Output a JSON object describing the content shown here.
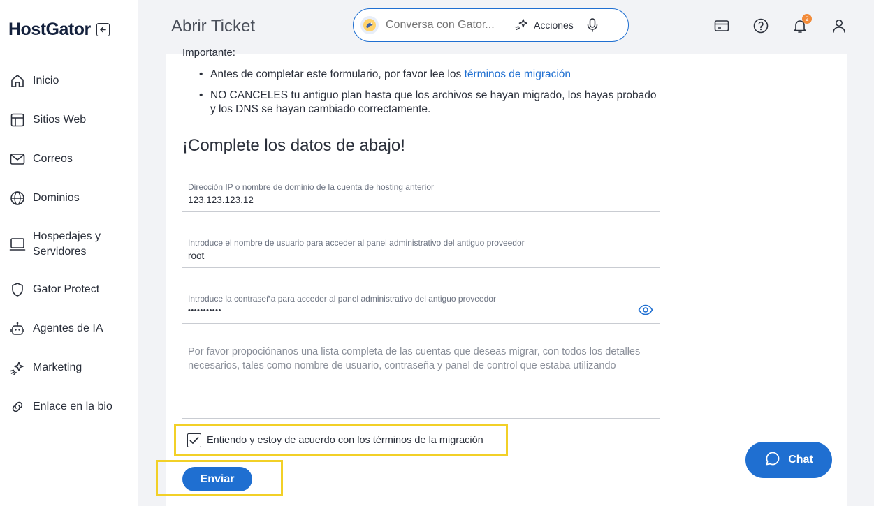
{
  "app": {
    "logo": "HostGator",
    "page_title": "Abrir Ticket"
  },
  "sidebar": {
    "items": [
      {
        "label": "Inicio",
        "icon": "home-icon"
      },
      {
        "label": "Sitios Web",
        "icon": "layout-icon"
      },
      {
        "label": "Correos",
        "icon": "mail-icon"
      },
      {
        "label": "Dominios",
        "icon": "globe-icon"
      },
      {
        "label": "Hospedajes y Servidores",
        "icon": "laptop-icon"
      },
      {
        "label": "Gator Protect",
        "icon": "shield-icon"
      },
      {
        "label": "Agentes de IA",
        "icon": "robot-icon"
      },
      {
        "label": "Marketing",
        "icon": "sparkle-icon"
      },
      {
        "label": "Enlace en la bio",
        "icon": "link-icon"
      }
    ]
  },
  "header": {
    "search_placeholder": "Conversa con Gator...",
    "actions_label": "Acciones",
    "notification_count": "2"
  },
  "content": {
    "important_heading": "Importante:",
    "bullet1_prefix": "Antes de completar este formulario, por favor lee los ",
    "bullet1_link": "términos de migración",
    "bullet2": "NO CANCELES tu antiguo plan hasta que los archivos se hayan migrado, los hayas probado y los DNS se hayan cambiado correctamente.",
    "section_title": "¡Complete los datos de abajo!",
    "fields": {
      "ip_label": "Dirección IP o nombre de dominio de la cuenta de hosting anterior",
      "ip_value": "123.123.123.12",
      "user_label": "Introduce el nombre de usuario para acceder al panel administrativo del antiguo proveedor",
      "user_value": "root",
      "password_label": "Introduce la contraseña para acceder al panel administrativo del antiguo proveedor",
      "password_value": "•••••••••••",
      "accounts_placeholder": "Por favor propociónanos una lista completa de las cuentas que deseas migrar, con todos los detalles necesarios, tales como nombre de usuario, contraseña y panel de control que estaba utilizando"
    },
    "checkbox_label": "Entiendo y estoy de acuerdo con los términos de la migración",
    "checkbox_checked": true,
    "submit_label": "Enviar"
  },
  "chat": {
    "label": "Chat"
  },
  "colors": {
    "accent": "#1f6fd1",
    "highlight": "#f2d027",
    "badge": "#f28b3a"
  }
}
